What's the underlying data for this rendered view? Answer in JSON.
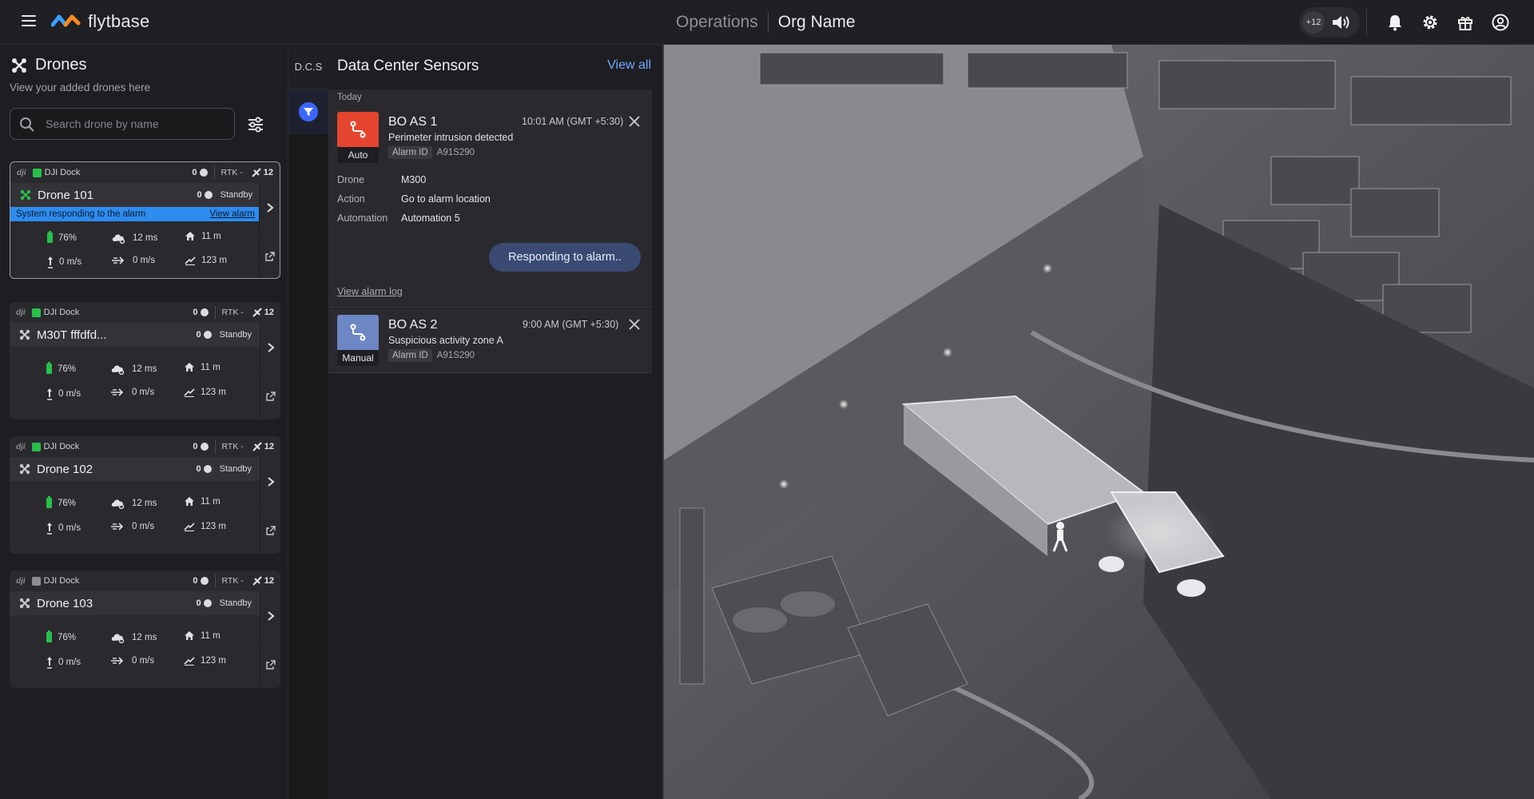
{
  "header": {
    "logo_text": "flytbase",
    "breadcrumb_section": "Operations",
    "breadcrumb_org": "Org Name",
    "audio_badge": "+12"
  },
  "drones_panel": {
    "title": "Drones",
    "subtitle": "View your added drones here",
    "search_placeholder": "Search drone by name"
  },
  "drones": [
    {
      "dock_brand": "dji",
      "dock_name": "DJI Dock",
      "dock_count": "0",
      "rtk": "RTK -",
      "satellites": "12",
      "name": "Drone 101",
      "drone_count": "0",
      "status": "Standby",
      "alarm_text": "System responding to the alarm",
      "alarm_link": "View alarm",
      "battery": "76%",
      "wind": "12 ms",
      "home_dist": "11 m",
      "vspeed": "0 m/s",
      "hspeed": "0 m/s",
      "altitude": "123 m",
      "selected": true,
      "dock_color": "#27c04a"
    },
    {
      "dock_brand": "dji",
      "dock_name": "DJI Dock",
      "dock_count": "0",
      "rtk": "RTK -",
      "satellites": "12",
      "name": "M30T fffdfd...",
      "drone_count": "0",
      "status": "Standby",
      "battery": "76%",
      "wind": "12 ms",
      "home_dist": "11 m",
      "vspeed": "0 m/s",
      "hspeed": "0 m/s",
      "altitude": "123 m",
      "selected": false,
      "dock_color": "#27c04a"
    },
    {
      "dock_brand": "dji",
      "dock_name": "DJI Dock",
      "dock_count": "0",
      "rtk": "RTK -",
      "satellites": "12",
      "name": "Drone 102",
      "drone_count": "0",
      "status": "Standby",
      "battery": "76%",
      "wind": "12 ms",
      "home_dist": "11 m",
      "vspeed": "0 m/s",
      "hspeed": "0 m/s",
      "altitude": "123 m",
      "selected": false,
      "dock_color": "#27c04a"
    },
    {
      "dock_brand": "dji",
      "dock_name": "DJI Dock",
      "dock_count": "0",
      "rtk": "RTK -",
      "satellites": "12",
      "name": "Drone 103",
      "drone_count": "0",
      "status": "Standby",
      "battery": "76%",
      "wind": "12 ms",
      "home_dist": "11 m",
      "vspeed": "0 m/s",
      "hspeed": "0 m/s",
      "altitude": "123 m",
      "selected": false,
      "dock_color": "#8c8c92"
    }
  ],
  "dcs_tab": {
    "label": "D.C.S"
  },
  "alarm_panel": {
    "title": "Data Center Sensors",
    "view_all": "View all",
    "section_label": "Today",
    "alarms": [
      {
        "title": "BO AS 1",
        "time": "10:01 AM (GMT +5:30)",
        "description": "Perimeter intrusion detected",
        "alarm_id_label": "Alarm ID",
        "alarm_id": "A91S290",
        "mode": "Auto",
        "mode_color": "#e5452f",
        "details": [
          {
            "key": "Drone",
            "value": "M300"
          },
          {
            "key": "Action",
            "value": "Go to alarm location"
          },
          {
            "key": "Automation",
            "value": "Automation 5"
          }
        ],
        "button": "Responding to alarm..",
        "log_link": "View alarm log"
      },
      {
        "title": "BO AS 2",
        "time": "9:00 AM (GMT +5:30)",
        "description": "Suspicious activity zone A",
        "alarm_id_label": "Alarm ID",
        "alarm_id": "A91S290",
        "mode": "Manual",
        "mode_color": "#6d86c4"
      }
    ]
  }
}
